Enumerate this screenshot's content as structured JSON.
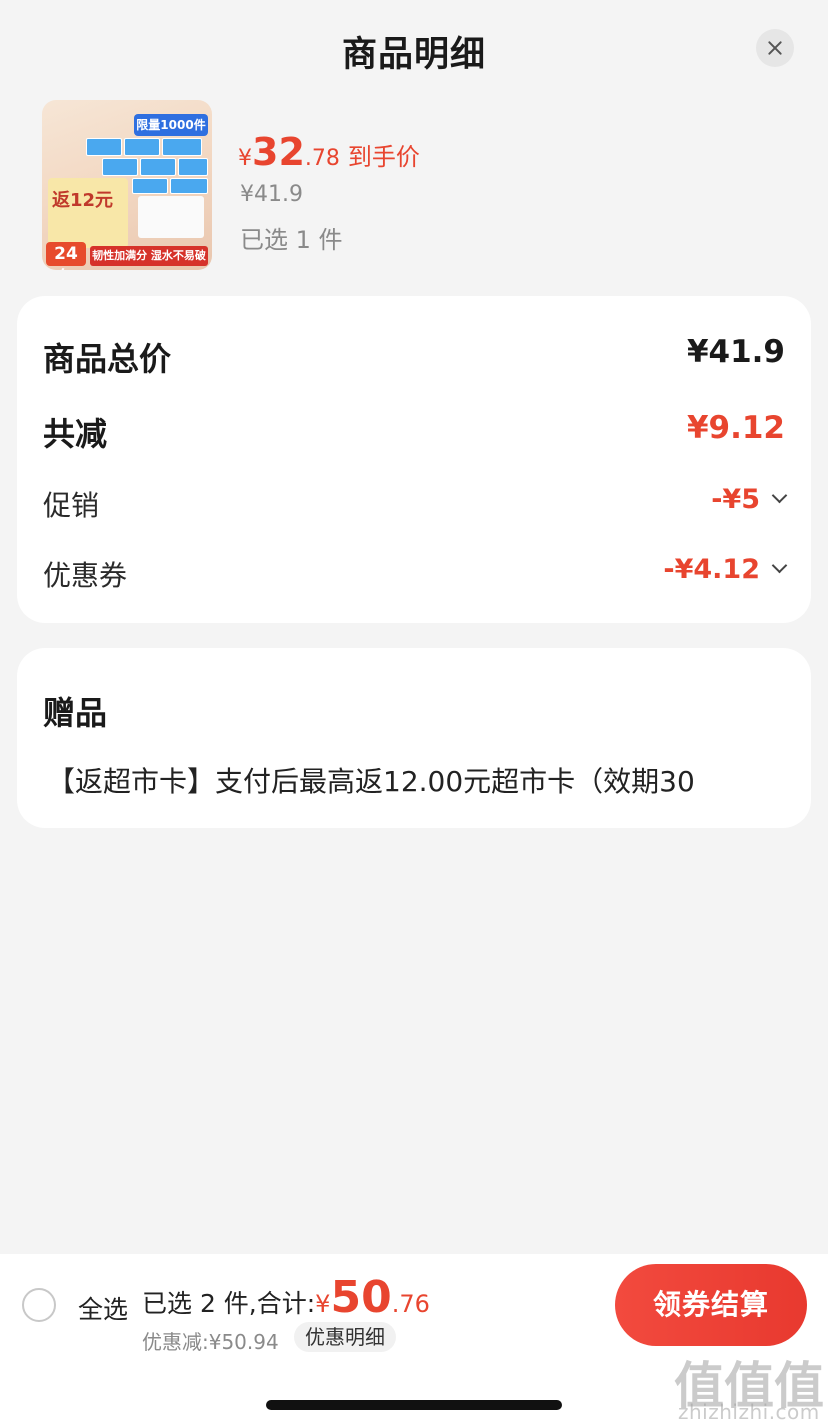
{
  "header": {
    "title": "商品明细"
  },
  "product": {
    "thumb": {
      "badge": "限量1000件",
      "card_text": "返12元",
      "count": "24包",
      "strip": "韧性加满分 湿水不易破"
    },
    "price": {
      "currency": "¥",
      "integer": "32",
      "decimal": ".78",
      "tag": "到手价"
    },
    "original_price": "¥41.9",
    "selected": "已选 1 件"
  },
  "summary": {
    "rows": [
      {
        "label": "商品总价",
        "value": "¥41.9"
      },
      {
        "label": "共减",
        "value": "¥9.12"
      },
      {
        "label": "促销",
        "value": "-¥5"
      },
      {
        "label": "优惠券",
        "value": "-¥4.12"
      }
    ]
  },
  "gift": {
    "title": "赠品",
    "text": "【返超市卡】支付后最高返12.00元超市卡（效期30"
  },
  "bottom": {
    "select_all": "全选",
    "total_prefix": "已选 2 件,合计:",
    "total_currency": "¥",
    "total_integer": "50",
    "total_decimal": ".76",
    "discount": "优惠减:¥50.94",
    "detail": "优惠明细",
    "checkout": "领券结算"
  },
  "watermark": {
    "glyphs": "值值值",
    "text": "zhizhizhi.com"
  },
  "colors": {
    "accent": "#e8452f",
    "button": "#f24a3e",
    "background": "#f4f4f4"
  }
}
